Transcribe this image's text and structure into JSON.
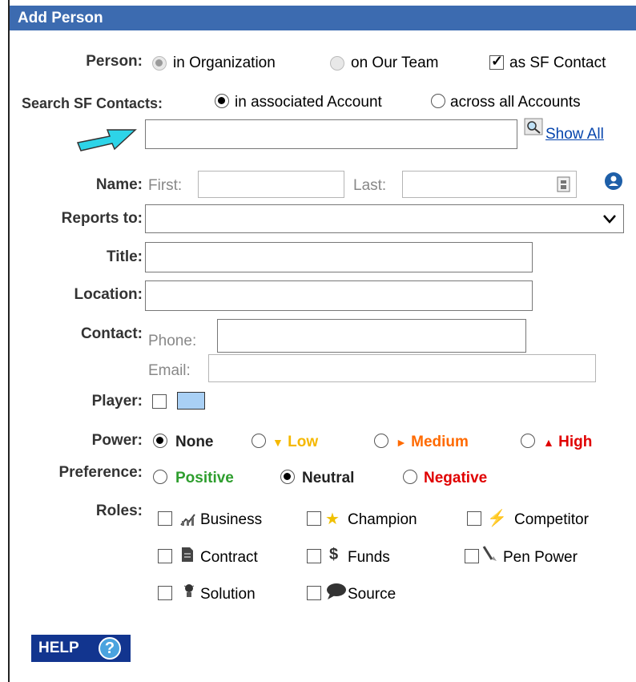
{
  "dialog": {
    "title": "Add Person"
  },
  "person": {
    "label": "Person:",
    "options": [
      "in Organization",
      "on Our Team"
    ],
    "selected": "in Organization",
    "sf_contact_label": "as SF Contact",
    "sf_contact_checked": true
  },
  "search": {
    "label": "Search SF Contacts:",
    "options": [
      "in associated Account",
      "across all Accounts"
    ],
    "selected": "in associated Account",
    "value": "",
    "show_all": "Show All"
  },
  "name": {
    "label": "Name:",
    "first_label": "First:",
    "last_label": "Last:",
    "first": "",
    "last": ""
  },
  "reports_to": {
    "label": "Reports to:",
    "value": ""
  },
  "title": {
    "label": "Title:",
    "value": ""
  },
  "location": {
    "label": "Location:",
    "value": ""
  },
  "contact": {
    "label": "Contact:",
    "phone_label": "Phone:",
    "email_label": "Email:",
    "phone": "",
    "email": ""
  },
  "player": {
    "label": "Player:",
    "checked": false,
    "color": "#a9d0f5"
  },
  "power": {
    "label": "Power:",
    "options": [
      "None",
      "Low",
      "Medium",
      "High"
    ],
    "selected": "None",
    "colors": {
      "None": "#000000",
      "Low": "#f5b800",
      "Medium": "#ff6a00",
      "High": "#e00000"
    }
  },
  "preference": {
    "label": "Preference:",
    "options": [
      "Positive",
      "Neutral",
      "Negative"
    ],
    "selected": "Neutral",
    "colors": {
      "Positive": "#2e9e2e",
      "Neutral": "#000000",
      "Negative": "#e00000"
    }
  },
  "roles": {
    "label": "Roles:",
    "items": [
      {
        "label": "Business",
        "icon": "chart-icon"
      },
      {
        "label": "Champion",
        "icon": "star-icon"
      },
      {
        "label": "Competitor",
        "icon": "lightning-icon"
      },
      {
        "label": "Contract",
        "icon": "document-icon"
      },
      {
        "label": "Funds",
        "icon": "dollar-icon"
      },
      {
        "label": "Pen Power",
        "icon": "pen-icon"
      },
      {
        "label": "Solution",
        "icon": "lightbulb-icon"
      },
      {
        "label": "Source",
        "icon": "speech-bubble-icon"
      }
    ]
  },
  "help": {
    "label": "HELP",
    "icon": "?"
  },
  "annotation": {
    "arrow_color": "#2dd4e8"
  }
}
